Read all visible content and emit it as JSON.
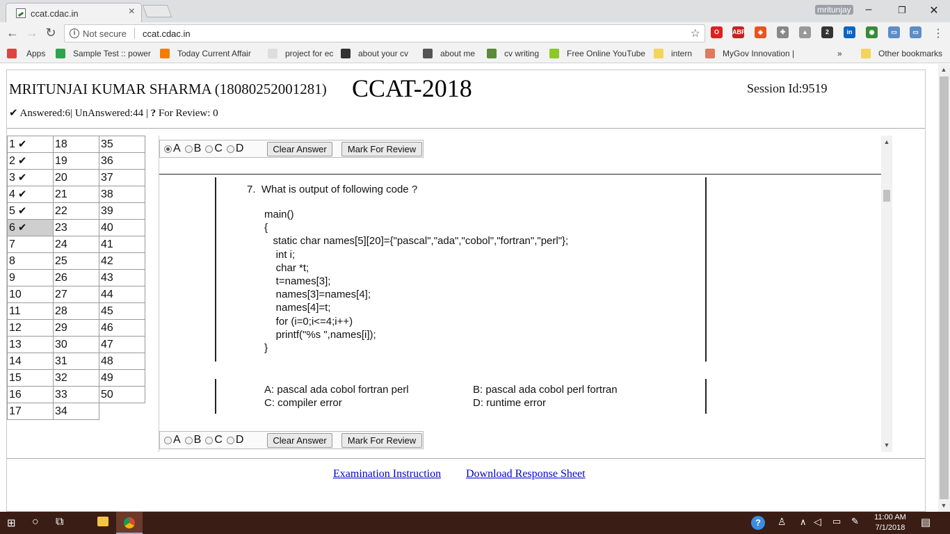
{
  "browser": {
    "tab_title": "ccat.cdac.in",
    "tab_close": "×",
    "user_name": "mritunjay",
    "window_minimize": "–",
    "window_restore": "❐",
    "window_close": "✕",
    "not_secure": "Not secure",
    "url": "ccat.cdac.in",
    "extensions": [
      {
        "label": "O",
        "color": "#e02020"
      },
      {
        "label": "ABP",
        "color": "#c5221f"
      },
      {
        "label": "◈",
        "color": "#e8551f"
      },
      {
        "label": "✚",
        "color": "#888888"
      },
      {
        "label": "▲",
        "color": "#999999"
      },
      {
        "label": "2",
        "color": "#333333"
      },
      {
        "label": "in",
        "color": "#0a66c2"
      },
      {
        "label": "◉",
        "color": "#3a8a3a"
      },
      {
        "label": "▭",
        "color": "#5b8dc9"
      },
      {
        "label": "▭",
        "color": "#5b8dc9"
      }
    ],
    "bookmarks": [
      {
        "label": "Apps",
        "color": "#d44"
      },
      {
        "label": "Sample Test :: power",
        "color": "#2ea44f"
      },
      {
        "label": "Today Current Affair",
        "color": "#f57c00"
      },
      {
        "label": "project for ec",
        "color": "#ddd"
      },
      {
        "label": "about your cv",
        "color": "#333"
      },
      {
        "label": "about me",
        "color": "#555"
      },
      {
        "label": "cv writing",
        "color": "#5a8a3a"
      },
      {
        "label": "Free Online YouTube",
        "color": "#8ac926"
      },
      {
        "label": "intern",
        "color": "#f4d35e"
      },
      {
        "label": "MyGov Innovation |",
        "color": "#e07a5f"
      }
    ],
    "bookmarks_more": "»",
    "other_bookmarks": "Other bookmarks"
  },
  "header": {
    "candidate": "MRITUNJAI KUMAR SHARMA (18080252001281)",
    "exam_title": "CCAT-2018",
    "session": "Session Id:9519",
    "answered": "Answered:6",
    "unanswered": "UnAnswered:44",
    "for_review": "For Review: 0"
  },
  "questions": {
    "col1": [
      "1",
      "2",
      "3",
      "4",
      "5",
      "6",
      "7",
      "8",
      "9",
      "10",
      "11",
      "12",
      "13",
      "14",
      "15",
      "16",
      "17"
    ],
    "col2": [
      "18",
      "19",
      "20",
      "21",
      "22",
      "23",
      "24",
      "25",
      "26",
      "27",
      "28",
      "29",
      "30",
      "31",
      "32",
      "33",
      "34"
    ],
    "col3": [
      "35",
      "36",
      "37",
      "38",
      "39",
      "40",
      "41",
      "42",
      "43",
      "44",
      "45",
      "46",
      "47",
      "48",
      "49",
      "50"
    ],
    "answered": [
      1,
      2,
      3,
      4,
      5,
      6
    ],
    "current": 6
  },
  "options_bar": {
    "options": [
      "A",
      "B",
      "C",
      "D"
    ],
    "selected": "A",
    "clear_label": "Clear Answer",
    "review_label": "Mark For Review"
  },
  "question": {
    "number": "7.",
    "text": "What is output of following code ?",
    "code": [
      "main()",
      "{",
      "   static char names[5][20]={\"pascal\",\"ada\",\"cobol\",\"fortran\",\"perl\"};",
      "    int i;",
      "    char *t;",
      "    t=names[3];",
      "    names[3]=names[4];",
      "    names[4]=t;",
      "    for (i=0;i<=4;i++)",
      "    printf(\"%s \",names[i]);",
      "}"
    ],
    "answers": {
      "a": "A: pascal ada cobol fortran perl",
      "b": "B: pascal ada cobol perl fortran",
      "c": "C: compiler error",
      "d": "D: runtime error"
    }
  },
  "footer": {
    "instruction_link": "Examination Instruction",
    "download_link": "Download Response Sheet"
  },
  "taskbar": {
    "time": "11:00 AM",
    "date": "7/1/2018"
  }
}
